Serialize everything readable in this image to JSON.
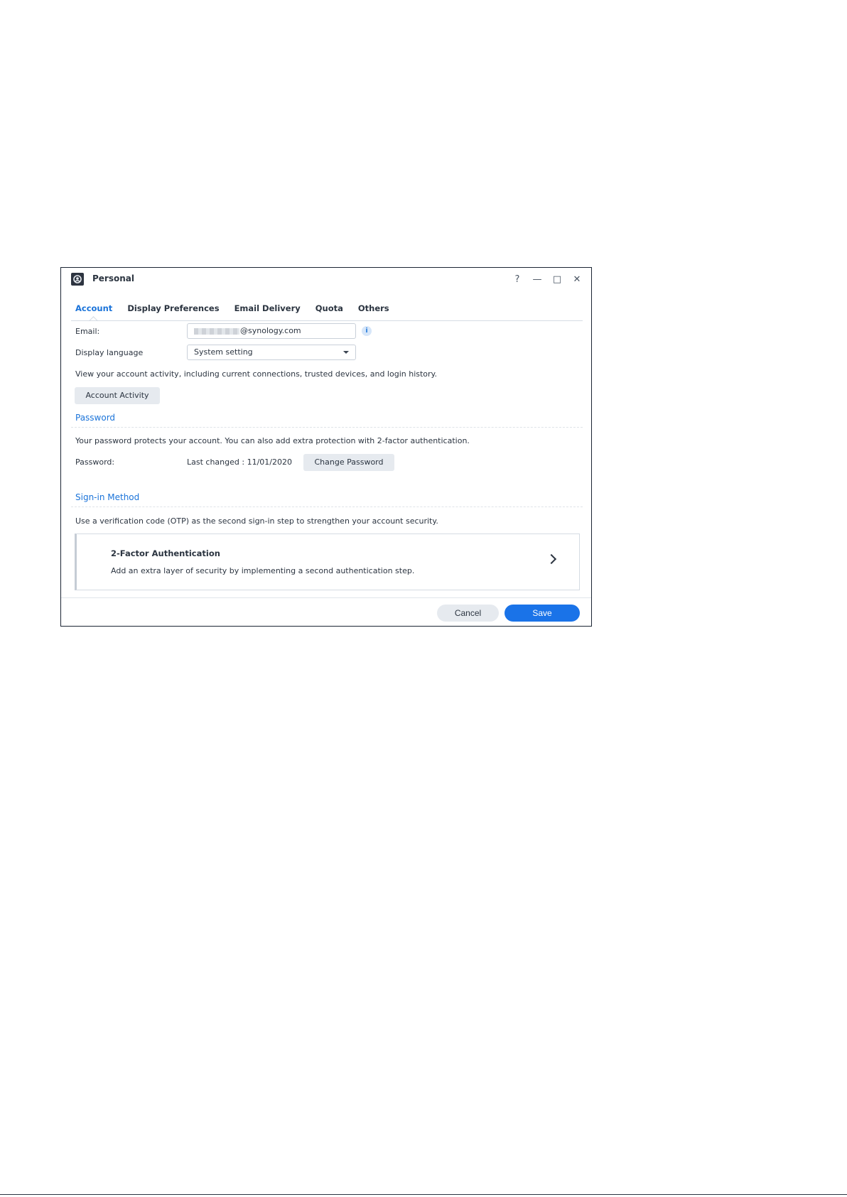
{
  "window": {
    "title": "Personal",
    "controls": {
      "help": "?",
      "minimize": "—",
      "maximize": "□",
      "close": "✕"
    }
  },
  "tabs": [
    {
      "label": "Account",
      "active": true
    },
    {
      "label": "Display Preferences",
      "active": false
    },
    {
      "label": "Email Delivery",
      "active": false
    },
    {
      "label": "Quota",
      "active": false
    },
    {
      "label": "Others",
      "active": false
    }
  ],
  "account": {
    "email_label": "Email:",
    "email_value": "@synology.com",
    "language_label": "Display language",
    "language_value": "System setting",
    "activity_text": "View your account activity, including current connections, trusted devices, and login history.",
    "activity_button": "Account Activity"
  },
  "password": {
    "section_title": "Password",
    "description": "Your password protects your account. You can also add extra protection with 2-factor authentication.",
    "label": "Password:",
    "last_changed": "Last changed : 11/01/2020",
    "change_button": "Change Password"
  },
  "signin": {
    "section_title": "Sign-in Method",
    "description": "Use a verification code (OTP) as the second sign-in step to strengthen your account security.",
    "card_title": "2-Factor Authentication",
    "card_desc": "Add an extra layer of security by implementing a second authentication step."
  },
  "footer": {
    "cancel": "Cancel",
    "save": "Save"
  },
  "colors": {
    "accent": "#1a73d9",
    "primary_button": "#1a73e8",
    "secondary_button": "#e6eaef",
    "text": "#2b3440"
  }
}
